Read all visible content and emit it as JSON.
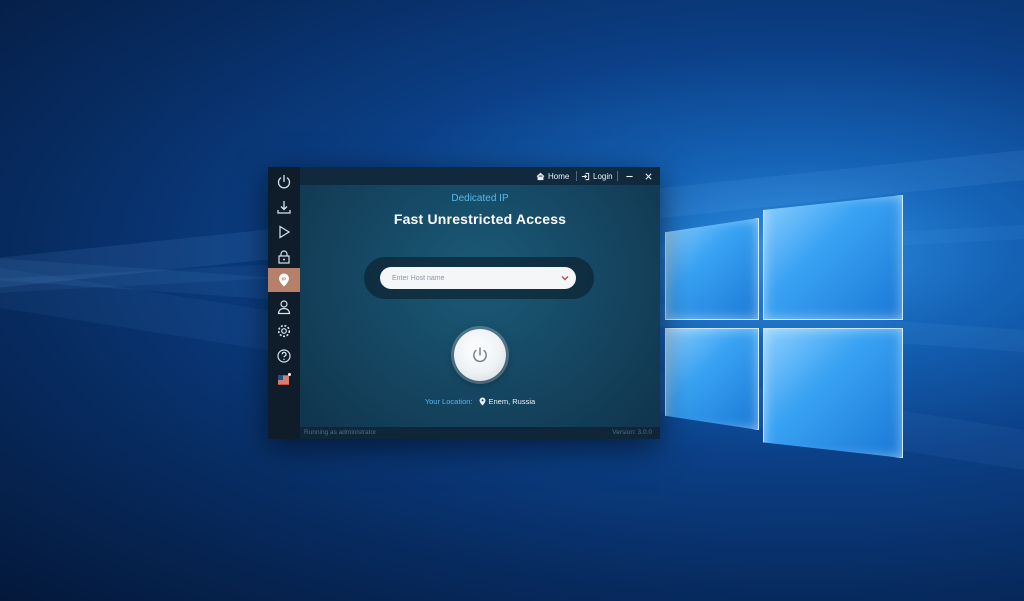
{
  "titlebar": {
    "home_label": "Home",
    "login_label": "Login"
  },
  "header": {
    "subtitle": "Dedicated IP",
    "title": "Fast Unrestricted Access"
  },
  "host": {
    "placeholder": "Enter Host name"
  },
  "location": {
    "label": "Your Location:",
    "value": "Enem, Russia"
  },
  "status": {
    "left": "Running as administrator",
    "right": "Version: 3.0.0"
  },
  "sidebar": {
    "items": [
      {
        "icon": "power-icon"
      },
      {
        "icon": "download-icon"
      },
      {
        "icon": "play-icon"
      },
      {
        "icon": "lock-icon"
      },
      {
        "icon": "dedicated-ip-icon",
        "active": true
      },
      {
        "icon": "user-icon"
      },
      {
        "icon": "gear-icon"
      },
      {
        "icon": "help-icon"
      },
      {
        "icon": "flag-icon"
      }
    ]
  },
  "colors": {
    "accent": "#5bb6ea",
    "active_sidebar": "#b7806a",
    "panel": "#164a66"
  }
}
